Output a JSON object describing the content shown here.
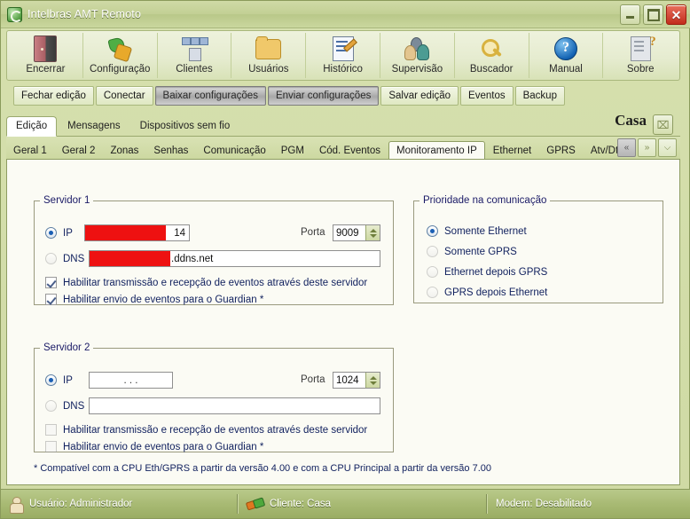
{
  "window": {
    "title": "Intelbras AMT Remoto",
    "icon": "app-refresh-icon",
    "minimize_label": "",
    "maximize_label": "",
    "close_label": "✕"
  },
  "toolbar": {
    "items": [
      {
        "label": "Encerrar",
        "icon": "door-exit-icon",
        "accel": "E"
      },
      {
        "label": "Configuração",
        "icon": "gear-tools-icon",
        "accel": "C"
      },
      {
        "label": "Clientes",
        "icon": "network-nodes-icon",
        "accel": "C"
      },
      {
        "label": "Usuários",
        "icon": "folder-icon",
        "accel": "U"
      },
      {
        "label": "Histórico",
        "icon": "document-pencil-icon",
        "accel": "H"
      },
      {
        "label": "Supervisão",
        "icon": "people-group-icon",
        "accel": "S"
      },
      {
        "label": "Buscador",
        "icon": "magnifier-icon",
        "accel": "B"
      },
      {
        "label": "Manual",
        "icon": "help-circle-icon",
        "accel": "M"
      },
      {
        "label": "Sobre",
        "icon": "document-question-icon",
        "accel": "S"
      }
    ]
  },
  "subbar": {
    "buttons": [
      {
        "label": "Fechar edição",
        "state": "normal"
      },
      {
        "label": "Conectar",
        "state": "normal"
      },
      {
        "label": "Baixar configurações",
        "state": "pressed"
      },
      {
        "label": "Enviar configurações",
        "state": "pressed"
      },
      {
        "label": "Salvar edição",
        "state": "normal"
      },
      {
        "label": "Eventos",
        "state": "normal"
      },
      {
        "label": "Backup",
        "state": "normal"
      }
    ]
  },
  "outer_tabs": {
    "items": [
      {
        "label": "Edição",
        "selected": true
      },
      {
        "label": "Mensagens",
        "selected": false
      },
      {
        "label": "Dispositivos sem fio",
        "selected": false
      }
    ],
    "client_name": "Casa",
    "close_icon": "⌧"
  },
  "inner_tabs": {
    "items": [
      {
        "label": "Geral 1",
        "selected": false
      },
      {
        "label": "Geral 2",
        "selected": false
      },
      {
        "label": "Zonas",
        "selected": false
      },
      {
        "label": "Senhas",
        "selected": false
      },
      {
        "label": "Comunicação",
        "selected": false
      },
      {
        "label": "PGM",
        "selected": false
      },
      {
        "label": "Cód. Eventos",
        "selected": false
      },
      {
        "label": "Monitoramento IP",
        "selected": true
      },
      {
        "label": "Ethernet",
        "selected": false
      },
      {
        "label": "GPRS",
        "selected": false
      },
      {
        "label": "Atv/Dtv",
        "selected": false
      }
    ],
    "nav": [
      {
        "icon": "chevron-left-icon",
        "glyph": "«",
        "state": "active"
      },
      {
        "icon": "chevron-right-icon",
        "glyph": "»",
        "state": "disabled"
      },
      {
        "icon": "tab-list-icon",
        "glyph": "⌵",
        "state": "disabled"
      }
    ]
  },
  "servidor1": {
    "legend": "Servidor 1",
    "ip_label": "IP",
    "ip_value": "14",
    "ip_selected": true,
    "ip_redacted": true,
    "porta_label": "Porta",
    "porta_value": "9009",
    "dns_label": "DNS",
    "dns_value": ".ddns.net",
    "dns_selected": false,
    "dns_redacted": true,
    "check1_label": "Habilitar transmissão e recepção de eventos através deste servidor",
    "check1_checked": true,
    "check2_label": "Habilitar envio de eventos para o Guardian *",
    "check2_checked": true
  },
  "servidor2": {
    "legend": "Servidor 2",
    "ip_label": "IP",
    "ip_value": "   .   .   .   ",
    "ip_selected": true,
    "porta_label": "Porta",
    "porta_value": "1024",
    "dns_label": "DNS",
    "dns_value": "",
    "dns_selected": false,
    "check1_label": "Habilitar transmissão e recepção de eventos através deste servidor",
    "check1_checked": false,
    "check2_label": "Habilitar envio de eventos para o Guardian *",
    "check2_checked": false
  },
  "prioridade": {
    "legend": "Prioridade na comunicação",
    "options": [
      {
        "label": "Somente Ethernet",
        "selected": true
      },
      {
        "label": "Somente GPRS",
        "selected": false
      },
      {
        "label": "Ethernet depois GPRS",
        "selected": false
      },
      {
        "label": "GPRS depois Ethernet",
        "selected": false
      }
    ]
  },
  "footnote": "* Compatível com a CPU Eth/GPRS a partir da versão 4.00 e com a CPU Principal a partir da versão 7.00",
  "status": {
    "user": "Usuário: Administrador",
    "user_icon": "user-icon",
    "client": "Cliente: Casa",
    "client_icon": "plug-connector-icon",
    "modem": "Modem: Desabilitado"
  },
  "colors": {
    "accent": "#9aad64",
    "title_bg": "#c3d095",
    "close_red": "#c22d1c",
    "redaction": "#ee1111",
    "label_blue": "#10205e"
  }
}
